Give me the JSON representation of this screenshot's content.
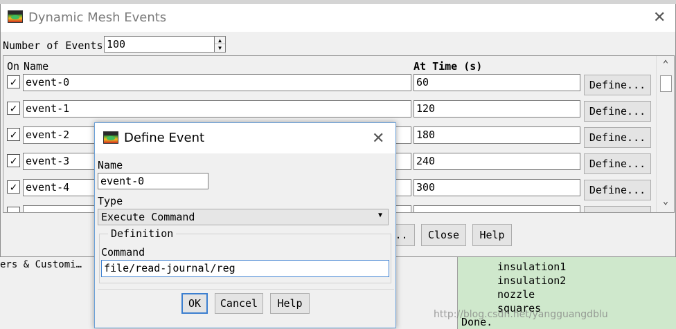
{
  "background": {
    "left_text": "ers & Customi…",
    "console_lines": [
      "insulation1",
      "insulation2",
      "nozzle",
      "squares",
      "Done."
    ],
    "watermark": "http://blog.csdn.net/yangguangdblu"
  },
  "main_dialog": {
    "title": "Dynamic Mesh Events",
    "number_of_events_label": "Number of Events",
    "number_of_events_value": "100",
    "columns": {
      "on": "On",
      "name": "Name",
      "at_time": "At Time (s)"
    },
    "rows": [
      {
        "on": true,
        "name": "event-0",
        "time": "60",
        "define_label": "Define..."
      },
      {
        "on": true,
        "name": "event-1",
        "time": "120",
        "define_label": "Define..."
      },
      {
        "on": true,
        "name": "event-2",
        "time": "180",
        "define_label": "Define..."
      },
      {
        "on": true,
        "name": "event-3",
        "time": "240",
        "define_label": "Define..."
      },
      {
        "on": true,
        "name": "event-4",
        "time": "300",
        "define_label": "Define..."
      }
    ],
    "check_glyph": "✓",
    "partial_button_label": "..",
    "close_label": "Close",
    "help_label": "Help"
  },
  "define_event": {
    "title": "Define Event",
    "name_label": "Name",
    "name_value": "event-0",
    "type_label": "Type",
    "type_value": "Execute Command",
    "definition_label": "Definition",
    "command_label": "Command",
    "command_value": "file/read-journal/reg",
    "ok_label": "OK",
    "cancel_label": "Cancel",
    "help_label": "Help"
  }
}
